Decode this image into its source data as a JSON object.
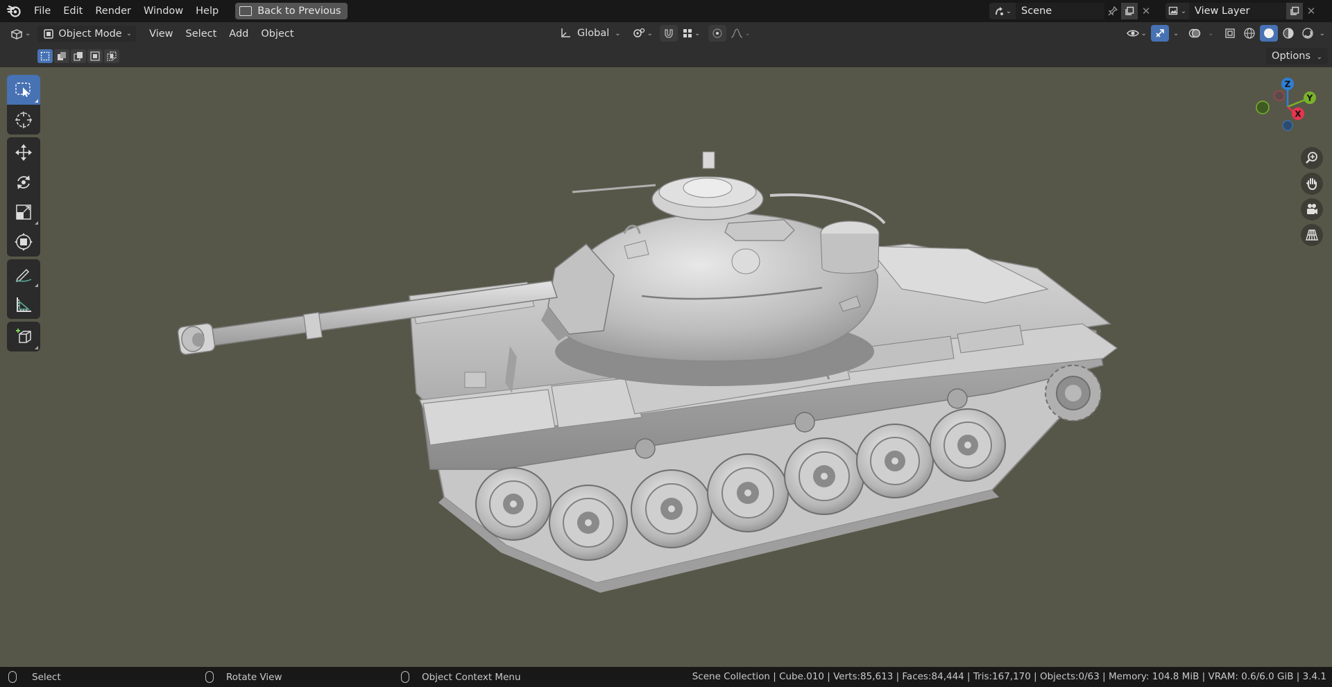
{
  "menubar": {
    "items": [
      "File",
      "Edit",
      "Render",
      "Window",
      "Help"
    ],
    "back_button": "Back to Previous",
    "scene_name": "Scene",
    "view_layer_name": "View Layer"
  },
  "header": {
    "mode": "Object Mode",
    "menus": [
      "View",
      "Select",
      "Add",
      "Object"
    ],
    "transform_orientation": "Global"
  },
  "subheader": {
    "options_label": "Options"
  },
  "gizmo": {
    "z": "Z",
    "y": "Y",
    "x": "X"
  },
  "statusbar": {
    "left_click": "Select",
    "middle_click": "Rotate View",
    "right_click": "Object Context Menu",
    "stats": "Scene Collection | Cube.010 | Verts:85,613 | Faces:84,444 | Tris:167,170 | Objects:0/63 | Memory: 104.8 MiB | VRAM: 0.6/6.0 GiB | 3.4.1"
  },
  "colors": {
    "accent": "#4772b3",
    "viewport_bg": "#575749",
    "axis_x": "#e8344e",
    "axis_y": "#7ab32a",
    "axis_z": "#2d7fd6"
  }
}
